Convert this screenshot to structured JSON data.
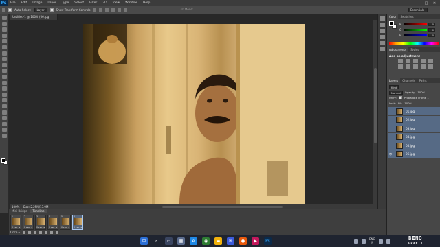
{
  "app": {
    "logo": "Ps",
    "menu": [
      "File",
      "Edit",
      "Image",
      "Layer",
      "Type",
      "Select",
      "Filter",
      "3D",
      "View",
      "Window",
      "Help"
    ],
    "window_buttons": [
      "—",
      "□",
      "✕"
    ]
  },
  "options_bar": {
    "auto_select_label": "Auto-Select:",
    "auto_select_value": "Layer",
    "show_transform_label": "Show Transform Controls",
    "mode_3d": "3D Mode:",
    "workspace": "Essentials"
  },
  "document": {
    "tab_title": "Untitled-1 @ 100% (06.jpg, RGB/8#) *",
    "zoom": "100%",
    "doc_size": "Doc: 2.25M/13.9M"
  },
  "timeline": {
    "tabs": [
      "Mini Bridge",
      "Timeline"
    ],
    "active_tab": "Timeline",
    "frames": [
      {
        "num": "1",
        "duration": "0 sec. ▾"
      },
      {
        "num": "2",
        "duration": "0 sec. ▾"
      },
      {
        "num": "3",
        "duration": "0 sec. ▾"
      },
      {
        "num": "4",
        "duration": "0 sec. ▾"
      },
      {
        "num": "5",
        "duration": "0 sec. ▾"
      },
      {
        "num": "6",
        "duration": "0 sec. ▾"
      }
    ],
    "loop": "Once ▾"
  },
  "panels": {
    "color_tabs": [
      "Color",
      "Swatches"
    ],
    "color_channels": [
      {
        "label": "R",
        "value": "0"
      },
      {
        "label": "G",
        "value": "0"
      },
      {
        "label": "B",
        "value": "0"
      }
    ],
    "adjust_tabs": [
      "Adjustments",
      "Styles"
    ],
    "adjust_title": "Add an adjustment",
    "layers_tabs": [
      "Layers",
      "Channels",
      "Paths"
    ],
    "kind_label": "Kind",
    "blend_mode": "Normal",
    "opacity_label": "Opacity:",
    "opacity_value": "100%",
    "unify_label": "Unify:",
    "propagate_label": "Propagate Frame 1",
    "lock_label": "Lock:",
    "fill_label": "Fill:",
    "fill_value": "100%",
    "layers": [
      "01.jpg",
      "02.jpg",
      "03.jpg",
      "04.jpg",
      "05.jpg",
      "06.jpg"
    ]
  },
  "taskbar": {
    "lang_line1": "ENG",
    "lang_line2": "IN",
    "watermark_line1": "BENO",
    "watermark_line2": "GRAFIX"
  }
}
